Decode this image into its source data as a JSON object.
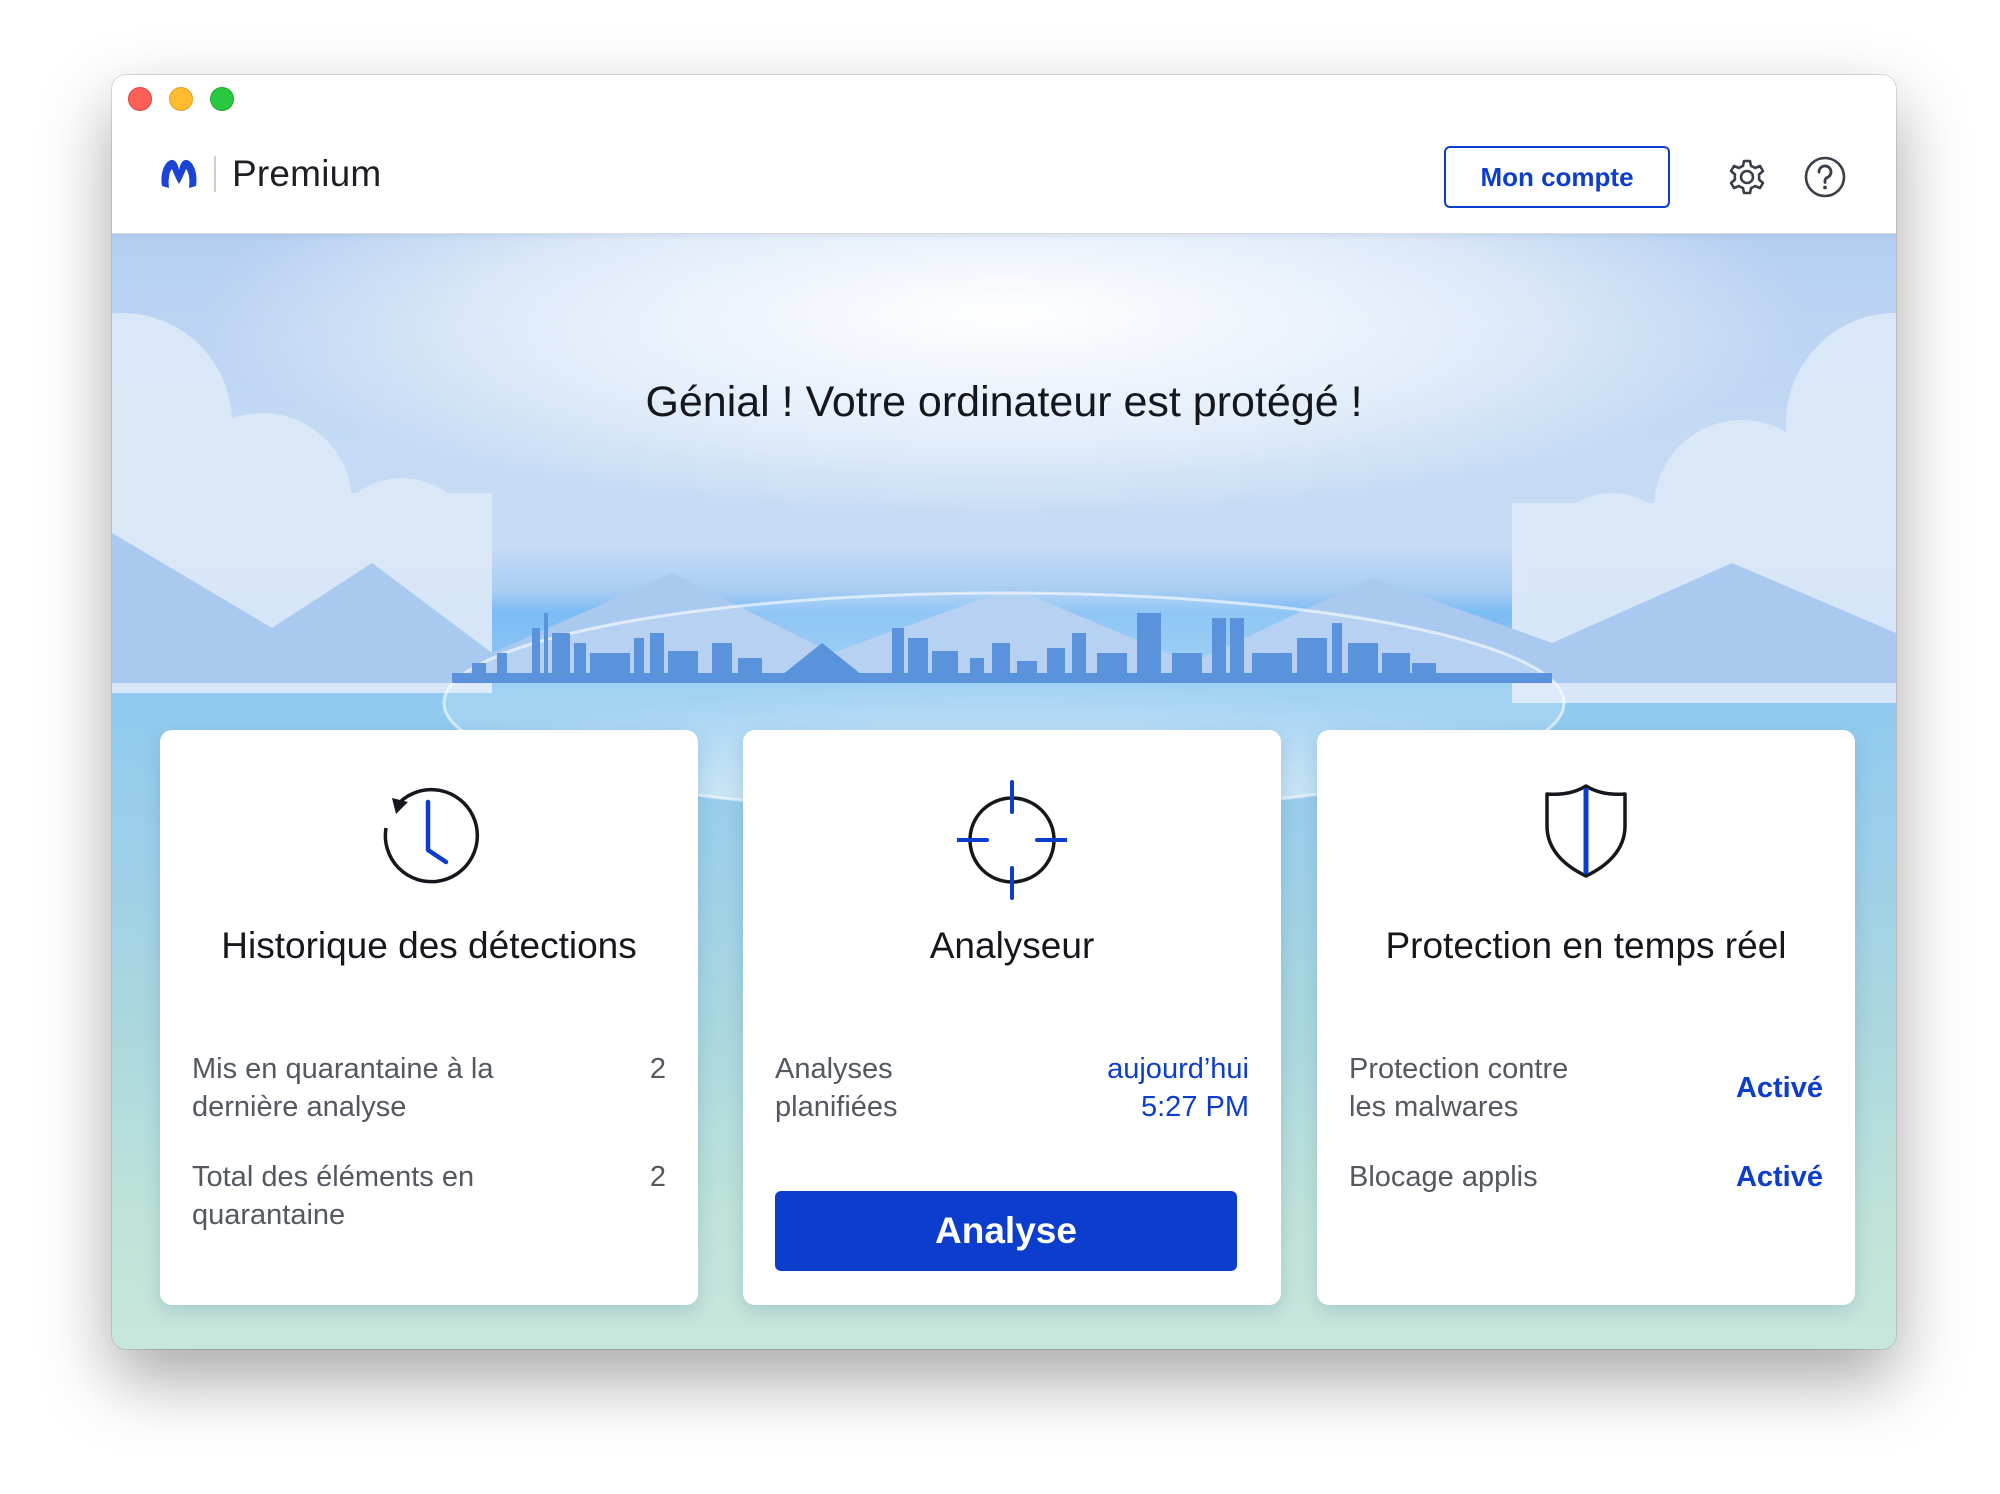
{
  "window": {
    "controls": [
      "close",
      "minimize",
      "zoom"
    ]
  },
  "header": {
    "logo_icon": "malwarebytes-logo-icon",
    "product_name": "Premium",
    "account_button_label": "Mon compte",
    "settings_icon": "gear-icon",
    "help_icon": "help-icon"
  },
  "hero": {
    "status_message": "Génial ! Votre ordinateur est protégé !"
  },
  "cards": {
    "detections": {
      "icon": "clock-history-icon",
      "title": "Historique des détections",
      "rows": [
        {
          "label": "Mis en quarantaine à la dernière analyse",
          "value": "2"
        },
        {
          "label": "Total des éléments en quarantaine",
          "value": "2"
        }
      ]
    },
    "scanner": {
      "icon": "crosshair-icon",
      "title": "Analyseur",
      "scheduled_label": "Analyses planifiées",
      "scheduled_day": "aujourd’hui",
      "scheduled_time": "5:27 PM",
      "scan_button_label": "Analyse"
    },
    "realtime": {
      "icon": "shield-icon",
      "title": "Protection en temps réel",
      "rows": [
        {
          "label": "Protection contre les malwares",
          "value": "Activé"
        },
        {
          "label": "Blocage applis",
          "value": "Activé"
        }
      ]
    }
  },
  "colors": {
    "accent": "#0d3dcc",
    "text_dark": "#15171c",
    "text_muted": "#535861"
  }
}
